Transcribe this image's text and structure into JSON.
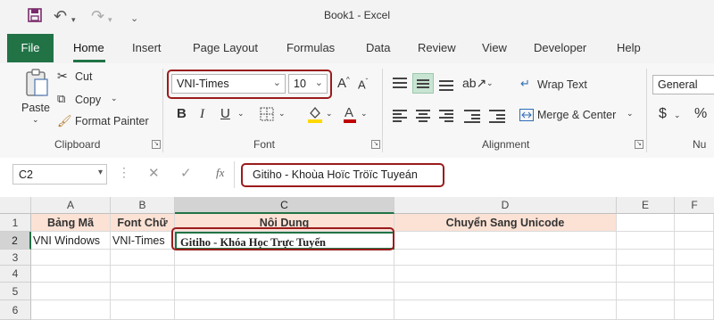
{
  "window": {
    "title": "Book1  -  Excel"
  },
  "qat": {
    "save_icon": "save-icon",
    "undo_icon": "undo-icon",
    "redo_icon": "redo-icon",
    "customize_icon": "chevron-down-icon"
  },
  "tabs": [
    "File",
    "Home",
    "Insert",
    "Page Layout",
    "Formulas",
    "Data",
    "Review",
    "View",
    "Developer",
    "Help"
  ],
  "clipboard": {
    "paste": "Paste",
    "cut": "Cut",
    "copy": "Copy",
    "format_painter": "Format Painter",
    "label": "Clipboard"
  },
  "font": {
    "name": "VNI-Times",
    "size": "10",
    "bold": "B",
    "italic": "I",
    "underline": "U",
    "label": "Font",
    "font_color": "#c00000"
  },
  "alignment": {
    "wrap_text": "Wrap Text",
    "merge_center": "Merge & Center",
    "label": "Alignment"
  },
  "number": {
    "format": "General",
    "currency": "$",
    "percent": "%",
    "label": "Nu"
  },
  "formula_bar": {
    "name_box": "C2",
    "fx": "fx",
    "content": "Gitiho - Khoùa Hoïc Tröïc Tuyeán"
  },
  "sheet": {
    "columns": [
      "A",
      "B",
      "C",
      "D",
      "E",
      "F"
    ],
    "rows": [
      "1",
      "2",
      "3",
      "4",
      "5",
      "6"
    ],
    "header_row": [
      "Bảng Mã",
      "Font Chữ",
      "Nội Dung",
      "Chuyển Sang Unicode"
    ],
    "data_row": [
      "VNI Windows",
      "VNI-Times",
      "Gitiho - Khóa Học Trực Tuyến",
      ""
    ],
    "header_fill": "#fbe2d5",
    "highlight_color": "#9b1c1c"
  }
}
